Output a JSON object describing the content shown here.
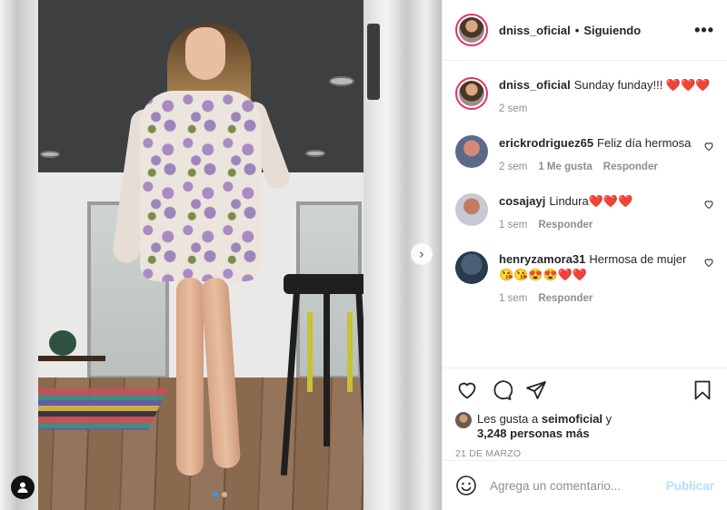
{
  "post": {
    "carousel_next_icon": "chevron-right-icon",
    "tag_icon": "user-tag-icon",
    "dots": 2,
    "active_dot": 1
  },
  "header": {
    "username": "dniss_oficial",
    "separator": "•",
    "follow_status": "Siguiendo",
    "more_icon": "more-horizontal-icon",
    "more_label": "•••"
  },
  "caption": {
    "username": "dniss_oficial",
    "text": "Sunday funday!!! ❤️❤️❤️",
    "time": "2 sem"
  },
  "comments": [
    {
      "username": "erickrodriguez65",
      "text": "Feliz día hermosa",
      "time": "2 sem",
      "likes": "1 Me gusta",
      "reply": "Responder"
    },
    {
      "username": "cosajayj",
      "text": "Lindura❤️❤️❤️",
      "time": "1 sem",
      "likes": "",
      "reply": "Responder"
    },
    {
      "username": "henryzamora31",
      "text": "Hermosa de mujer 😘😘😍😍❤️❤️",
      "time": "1 sem",
      "likes": "",
      "reply": "Responder"
    }
  ],
  "actions": {
    "like_icon": "heart-icon",
    "comment_icon": "comment-icon",
    "share_icon": "send-icon",
    "save_icon": "bookmark-icon"
  },
  "likes": {
    "prefix": "Les gusta a",
    "liker": "seimoficial",
    "conj": "y",
    "others": "3,248 personas más"
  },
  "date": "21 DE MARZO",
  "composer": {
    "placeholder": "Agrega un comentario...",
    "post_label": "Publicar",
    "emoji_icon": "smiley-icon"
  },
  "colors": {
    "story_ring": "#e0336f",
    "muted": "#8e8e8e",
    "post_disabled": "#b2dffc",
    "active_dot": "#2d9bf0"
  }
}
